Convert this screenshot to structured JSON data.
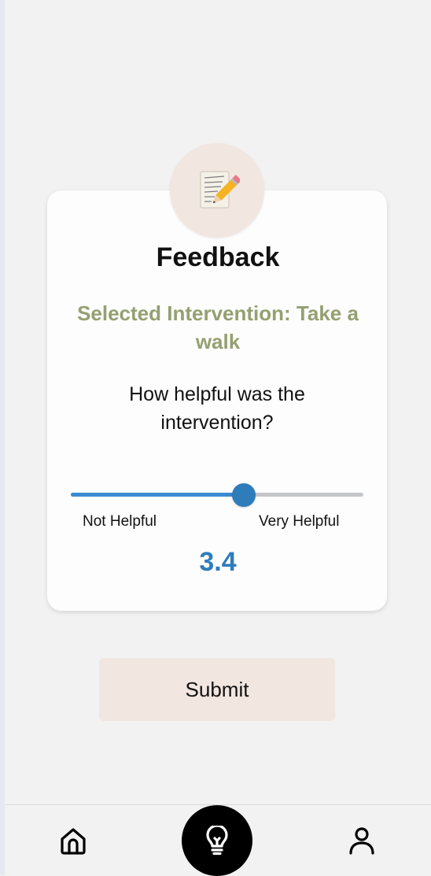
{
  "feedback": {
    "icon": "memo-pencil-icon",
    "title": "Feedback",
    "selected_intervention": "Selected Intervention: Take a walk",
    "question": "How helpful was the intervention?",
    "slider": {
      "min_label": "Not Helpful",
      "max_label": "Very Helpful",
      "min": 1,
      "max": 5,
      "value": 3.4,
      "value_text": "3.4"
    },
    "submit_label": "Submit"
  },
  "navbar": {
    "items": [
      {
        "icon": "home-icon",
        "active": false
      },
      {
        "icon": "lightbulb-icon",
        "active": true
      },
      {
        "icon": "user-icon",
        "active": false
      }
    ]
  },
  "colors": {
    "background": "#f2f2f2",
    "card": "#fdfdfd",
    "accent_blue": "#2f7cbb",
    "olive_text": "#94a071",
    "peach": "#f1e6e0",
    "track_gray": "#c4c6c9"
  }
}
